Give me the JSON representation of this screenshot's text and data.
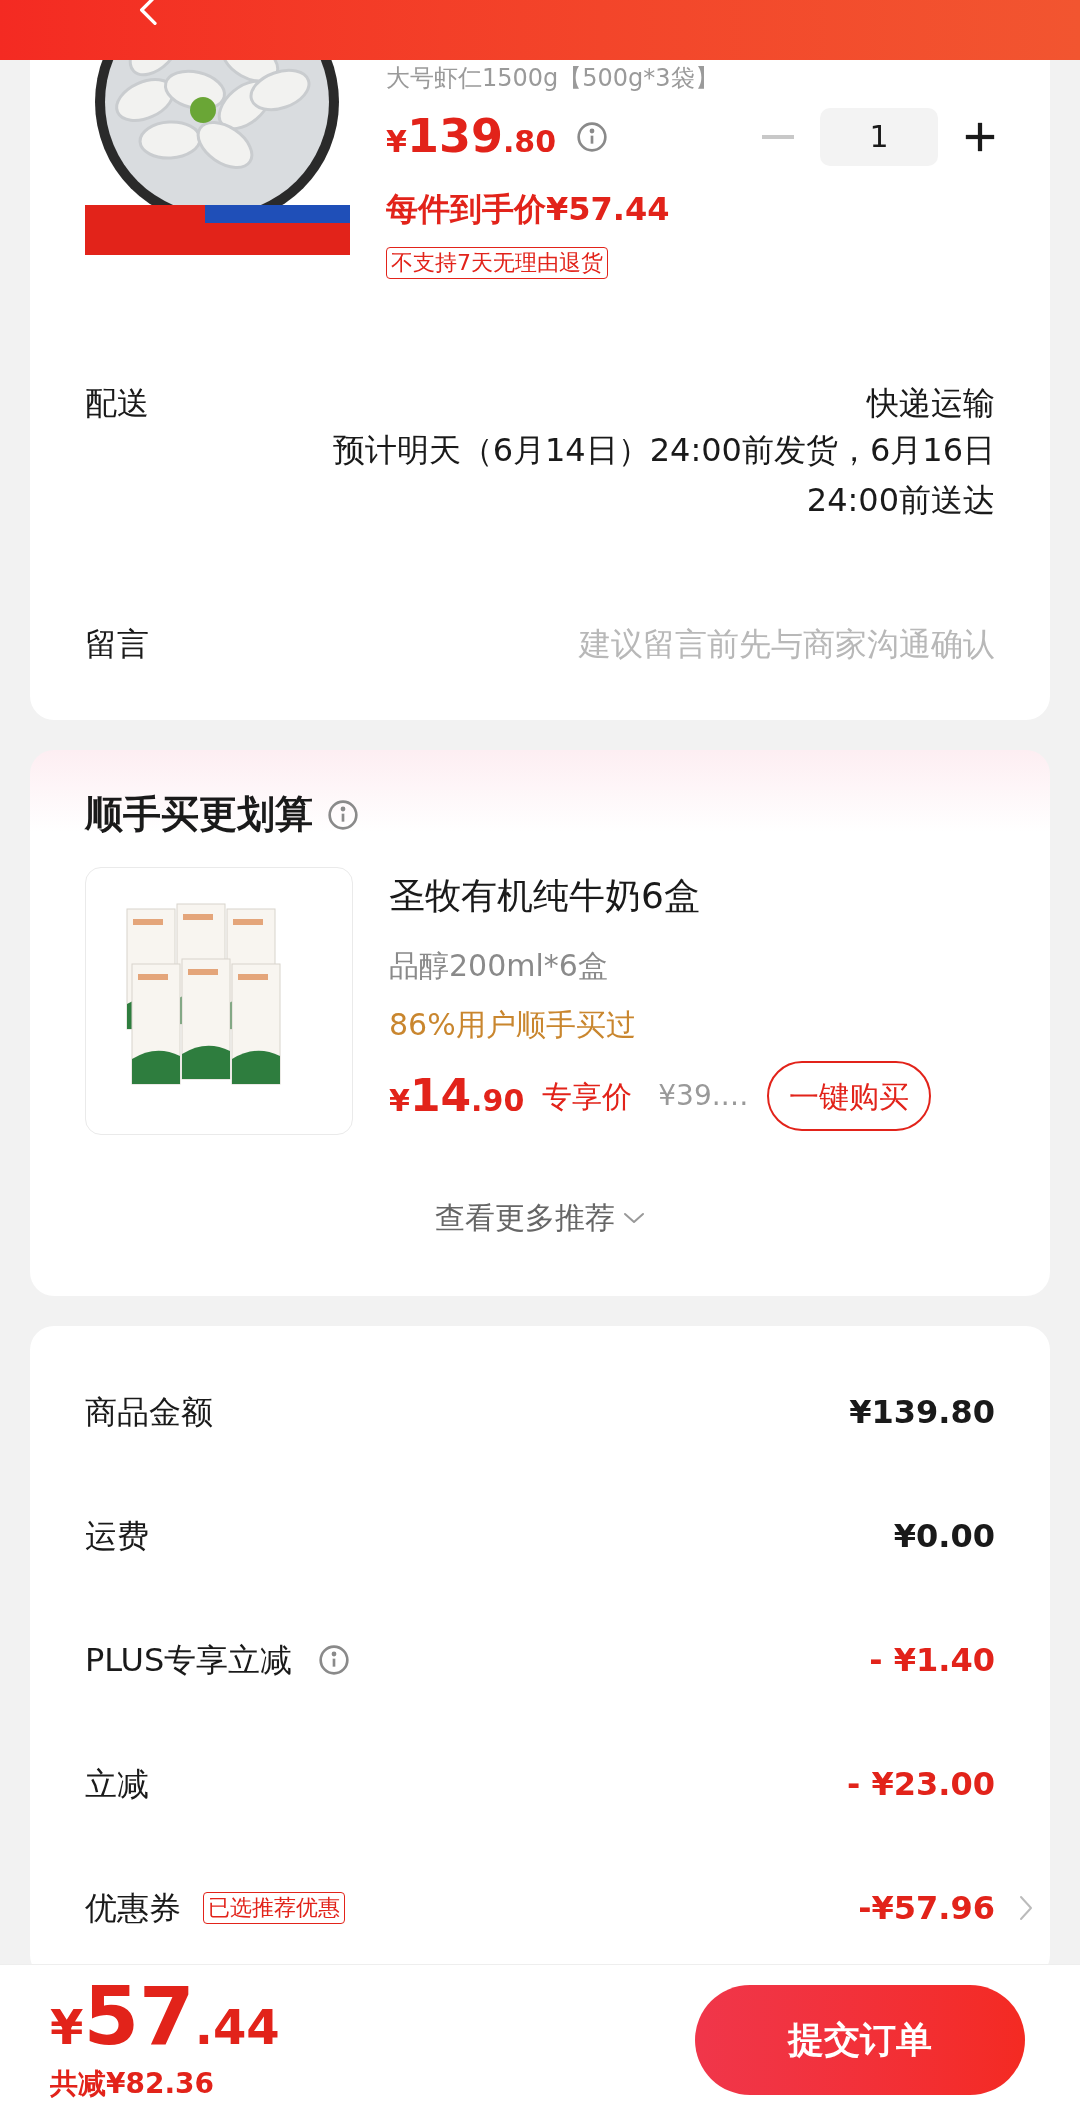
{
  "product": {
    "spec": "大号虾仁1500g【500g*3袋】",
    "price": {
      "currency": "¥",
      "integer": "139",
      "decimal": ".80"
    },
    "quantity": "1",
    "minus_disabled": true,
    "unit_price": "每件到手价¥57.44",
    "tag": "不支持7天无理由退货"
  },
  "delivery": {
    "label": "配送",
    "method": "快递运输",
    "estimate": "预计明天（6月14日）24:00前发货，6月16日24:00前送达"
  },
  "message": {
    "label": "留言",
    "placeholder": "建议留言前先与商家沟通确认"
  },
  "recommend": {
    "title": "顺手买更划算",
    "item": {
      "name": "圣牧有机纯牛奶6盒",
      "spec": "品醇200ml*6盒",
      "popularity": "86%用户顺手买过",
      "price": {
        "currency": "¥",
        "integer": "14",
        "decimal": ".90"
      },
      "price_label": "专享价",
      "original_price": "¥39.…",
      "button": "一键购买"
    },
    "more": "查看更多推荐"
  },
  "summary": [
    {
      "label": "商品金额",
      "value": "¥139.80",
      "highlight": false,
      "info": false,
      "chevron": false
    },
    {
      "label": "运费",
      "value": "¥0.00",
      "highlight": false,
      "info": false,
      "chevron": false
    },
    {
      "label": "PLUS专享立减",
      "value": "- ¥1.40",
      "highlight": true,
      "info": true,
      "chevron": false
    },
    {
      "label": "立减",
      "value": "- ¥23.00",
      "highlight": true,
      "info": false,
      "chevron": false
    },
    {
      "label": "优惠券",
      "tag": "已选推荐优惠",
      "value": "-¥57.96",
      "highlight": true,
      "info": false,
      "chevron": true
    }
  ],
  "footer": {
    "total": {
      "currency": "¥",
      "integer": "57",
      "decimal": ".44"
    },
    "saved": "共减¥82.36",
    "button": "提交订单"
  }
}
